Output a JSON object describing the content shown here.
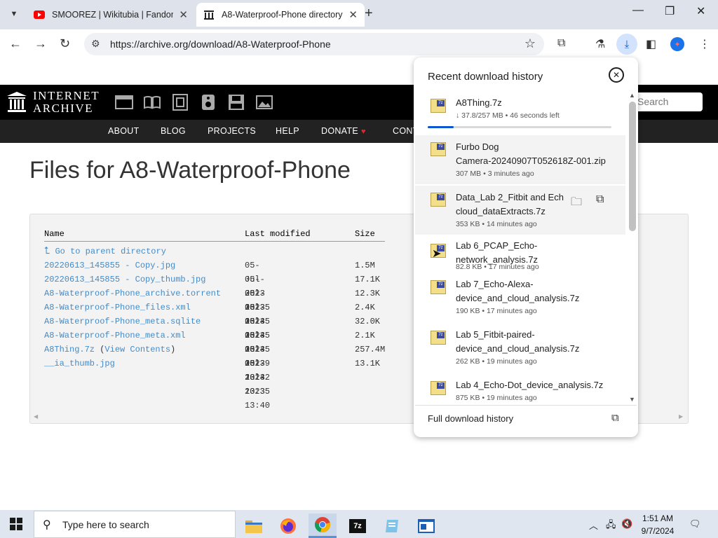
{
  "tabs": [
    {
      "title": "SMOOREZ | Wikitubia | Fandom",
      "active": false
    },
    {
      "title": "A8-Waterproof-Phone directory",
      "active": true
    }
  ],
  "toolbar": {
    "url": "https://archive.org/download/A8-Waterproof-Phone"
  },
  "ia": {
    "logo_line1": "INTERNET",
    "logo_line2": "ARCHIVE",
    "search_placeholder": "Search",
    "nav": [
      "ABOUT",
      "BLOG",
      "PROJECTS",
      "HELP",
      "DONATE",
      "CONTACT US"
    ]
  },
  "page": {
    "title": "Files for A8-Waterproof-Phone",
    "columns": {
      "name": "Name",
      "modified": "Last modified",
      "size": "Size"
    },
    "parent_link": "Go to parent directory",
    "files": [
      {
        "name": "20220613_145855 - Copy.jpg",
        "modified": "05-Jul-2023 13:35",
        "size": "1.5M"
      },
      {
        "name": "20220613_145855 - Copy_thumb.jpg",
        "modified": "05-Jul-2023 13:45",
        "size": "17.1K"
      },
      {
        "name": "A8-Waterproof-Phone_archive.torrent",
        "modified": "05-Jul-2023 13:45",
        "size": "12.3K"
      },
      {
        "name": "A8-Waterproof-Phone_files.xml",
        "modified": "05-Jul-2023 13:45",
        "size": "2.4K"
      },
      {
        "name": "A8-Waterproof-Phone_meta.sqlite",
        "modified": "05-Jul-2023 13:39",
        "size": "32.0K"
      },
      {
        "name": "A8-Waterproof-Phone_meta.xml",
        "modified": "05-Jul-2023 13:42",
        "size": "2.1K"
      },
      {
        "name": "A8Thing.7z",
        "extra_open": " (",
        "extra_link": "View Contents",
        "extra_close": ")",
        "modified": "05-Jul-2023 13:35",
        "size": "257.4M"
      },
      {
        "name": "__ia_thumb.jpg",
        "modified": "05-Jul-2023 13:40",
        "size": "13.1K"
      }
    ]
  },
  "downloads": {
    "title": "Recent download history",
    "items": [
      {
        "name_lines": [
          "A8Thing.7z"
        ],
        "meta": "↓ 37.8/257 MB • 46 seconds left",
        "progress": 0.14
      },
      {
        "name_lines": [
          "Furbo Dog",
          "Camera-20240907T052618Z-001.zip"
        ],
        "meta": "307 MB • 3 minutes ago"
      },
      {
        "name_lines": [
          "Data_Lab 2_Fitbit and Ech",
          "cloud_dataExtracts.7z"
        ],
        "meta": "353 KB • 14 minutes ago"
      },
      {
        "name_lines": [
          "Lab 6_PCAP_Echo-",
          "network_analysis.7z"
        ],
        "meta": "82.8 KB • 17 minutes ago"
      },
      {
        "name_lines": [
          "Lab 7_Echo-Alexa-",
          "device_and_cloud_analysis.7z"
        ],
        "meta": "190 KB • 17 minutes ago"
      },
      {
        "name_lines": [
          "Lab 5_Fitbit-paired-",
          "device_and_cloud_analysis.7z"
        ],
        "meta": "262 KB • 19 minutes ago"
      },
      {
        "name_lines": [
          "Lab 4_Echo-Dot_device_analysis.7z"
        ],
        "meta": "875 KB • 19 minutes ago"
      }
    ],
    "footer": "Full download history"
  },
  "taskbar": {
    "search_placeholder": "Type here to search",
    "time": "1:51 AM",
    "date": "9/7/2024"
  }
}
